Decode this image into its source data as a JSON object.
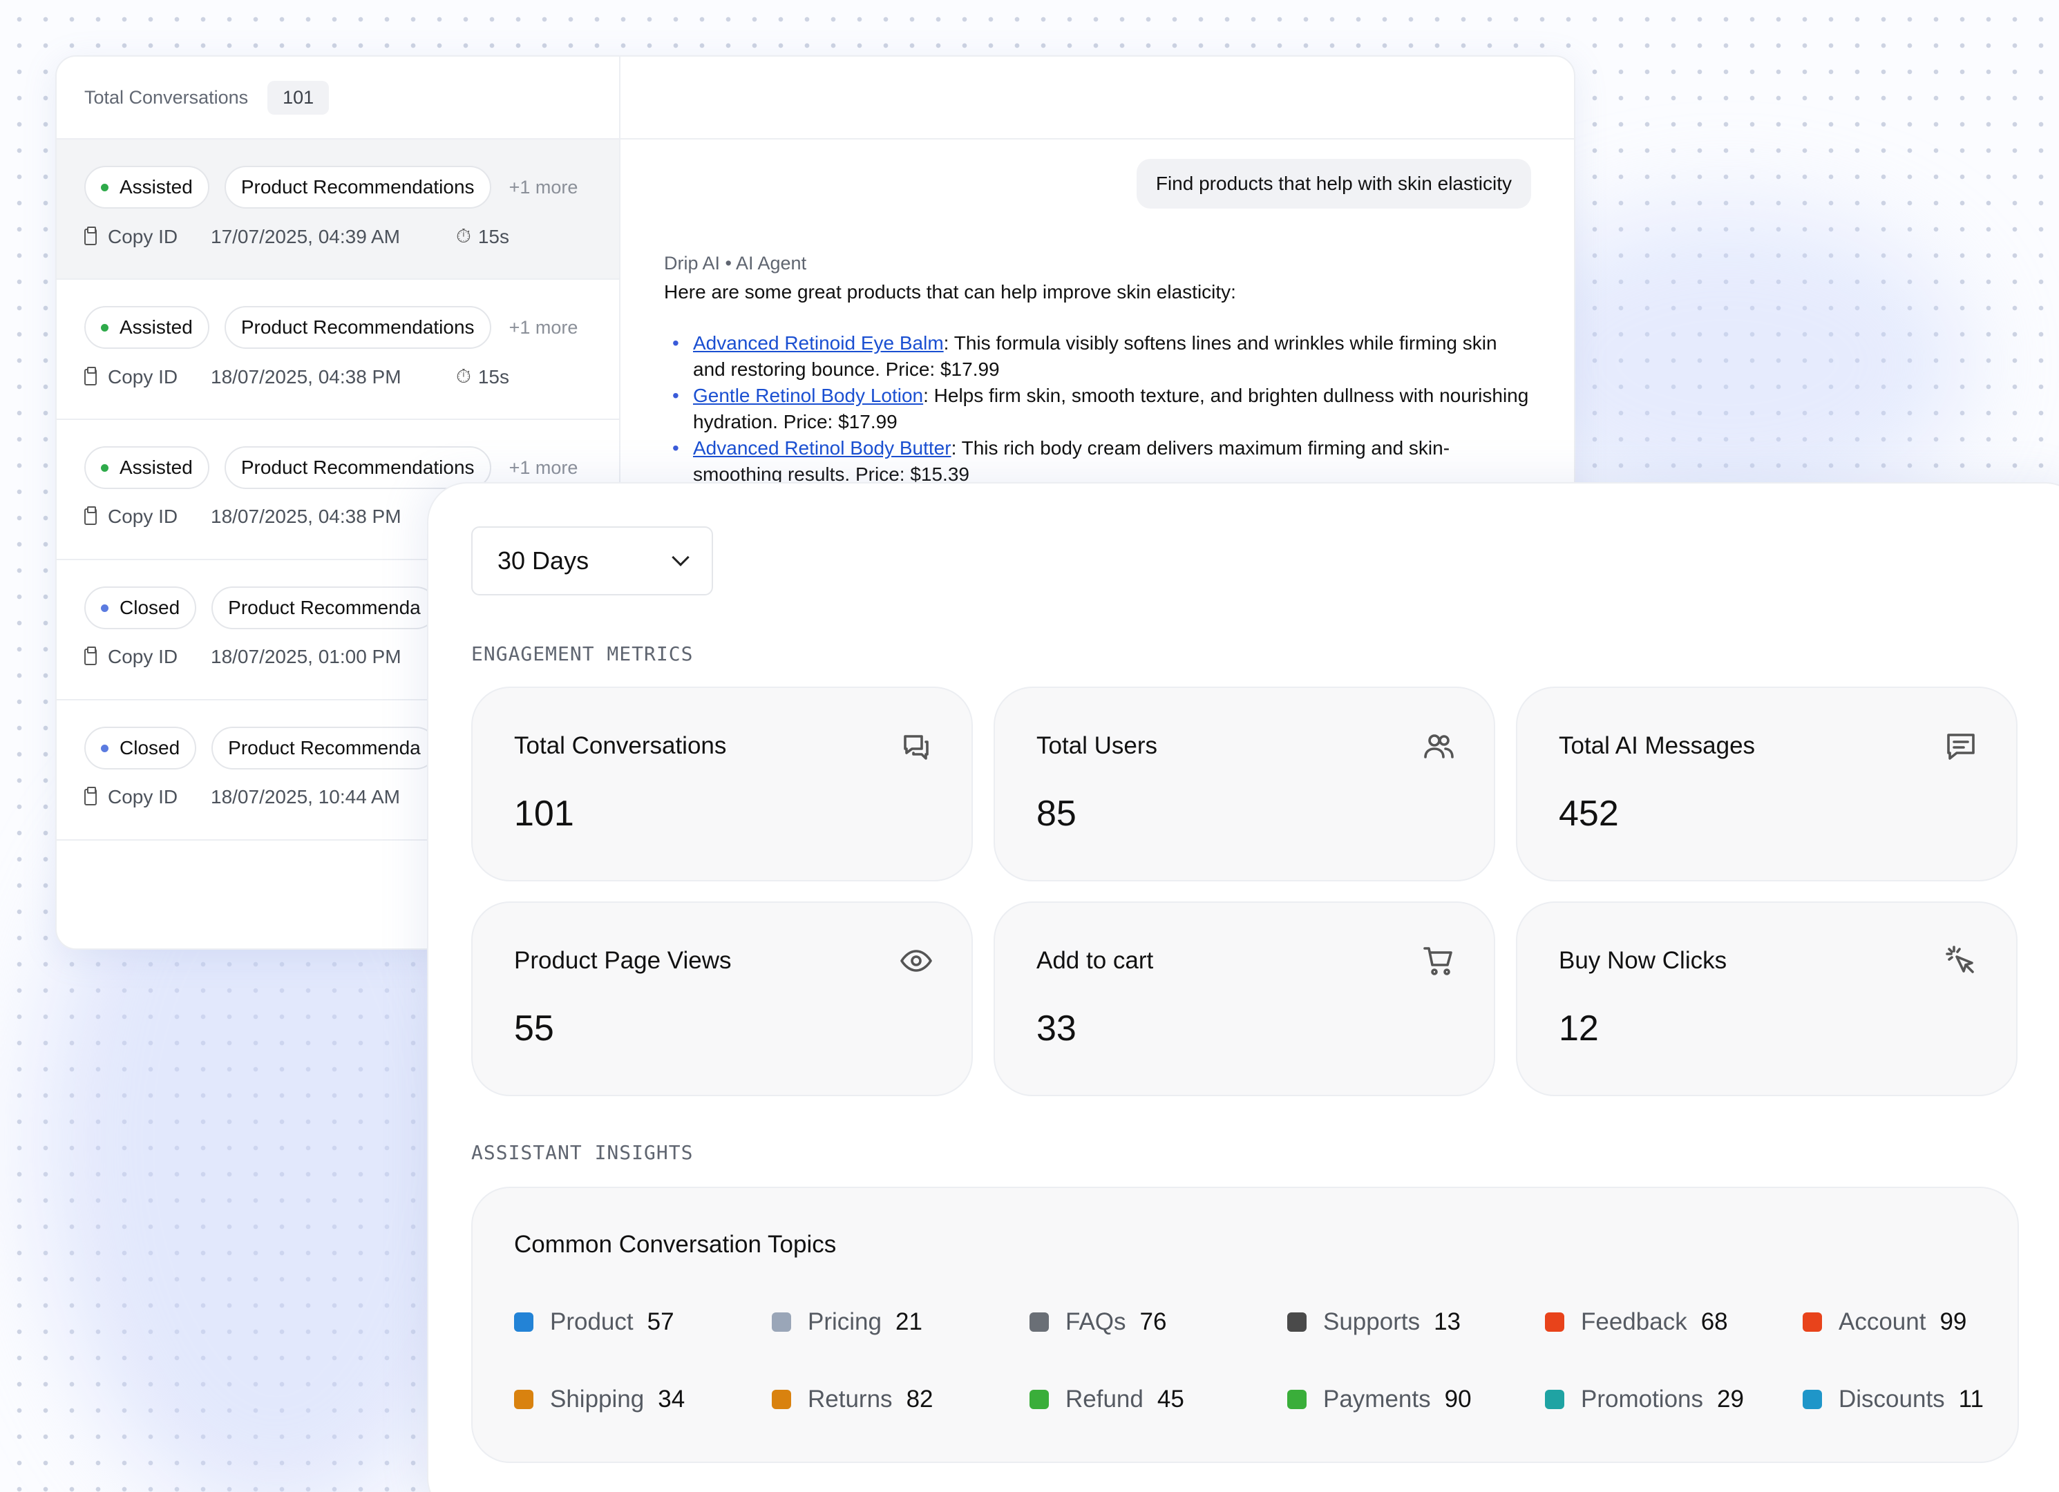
{
  "conversations_panel": {
    "header_title": "Total Conversations",
    "header_count": "101",
    "items": [
      {
        "status": "Assisted",
        "status_color": "#2eaa4a",
        "topic": "Product Recommendations",
        "more": "+1 more",
        "copy": "Copy ID",
        "time": "17/07/2025, 04:39 AM",
        "duration": "15s"
      },
      {
        "status": "Assisted",
        "status_color": "#2eaa4a",
        "topic": "Product Recommendations",
        "more": "+1 more",
        "copy": "Copy ID",
        "time": "18/07/2025, 04:38 PM",
        "duration": "15s"
      },
      {
        "status": "Assisted",
        "status_color": "#2eaa4a",
        "topic": "Product Recommendations",
        "more": "+1 more",
        "copy": "Copy ID",
        "time": "18/07/2025, 04:38 PM"
      },
      {
        "status": "Closed",
        "status_color": "#5b7be0",
        "topic": "Product Recommenda",
        "copy": "Copy ID",
        "time": "18/07/2025, 01:00 PM"
      },
      {
        "status": "Closed",
        "status_color": "#5b7be0",
        "topic": "Product Recommenda",
        "copy": "Copy ID",
        "time": "18/07/2025, 10:44 AM"
      }
    ]
  },
  "chat": {
    "user_message": "Find products that help with skin elasticity",
    "agent_label": "Drip AI • AI Agent",
    "agent_intro": "Here are some great products that can help improve skin elasticity:",
    "products": [
      {
        "name": "Advanced Retinoid Eye Balm",
        "desc": ": This formula visibly softens lines and wrinkles while firming skin and restoring bounce. Price: ",
        "price": "$17.99"
      },
      {
        "name": "Gentle Retinol Body Lotion",
        "desc": ": Helps firm skin, smooth texture, and brighten dullness with nourishing hydration. Price: ",
        "price": "$17.99"
      },
      {
        "name": "Advanced Retinol Body Butter",
        "desc": ": This rich body cream delivers maximum firming and skin-smoothing results. Price: ",
        "price": "$15.39"
      }
    ]
  },
  "metrics_panel": {
    "period": "30 Days",
    "engagement_label": "ENGAGEMENT METRICS",
    "insights_label": "ASSISTANT INSIGHTS",
    "metrics": [
      {
        "title": "Total Conversations",
        "value": "101",
        "icon": "chat-bubbles-icon"
      },
      {
        "title": "Total Users",
        "value": "85",
        "icon": "users-icon"
      },
      {
        "title": "Total AI Messages",
        "value": "452",
        "icon": "message-icon"
      },
      {
        "title": "Product Page Views",
        "value": "55",
        "icon": "eye-icon"
      },
      {
        "title": "Add to cart",
        "value": "33",
        "icon": "cart-icon"
      },
      {
        "title": "Buy Now Clicks",
        "value": "12",
        "icon": "cursor-click-icon"
      }
    ],
    "topics_title": "Common Conversation Topics",
    "topics": [
      {
        "name": "Product",
        "count": "57",
        "color": "#2383d6"
      },
      {
        "name": "Pricing",
        "count": "21",
        "color": "#9aa6b8"
      },
      {
        "name": "FAQs",
        "count": "76",
        "color": "#6a6f76"
      },
      {
        "name": "Supports",
        "count": "13",
        "color": "#4a4a4a"
      },
      {
        "name": "Feedback",
        "count": "68",
        "color": "#e8431b"
      },
      {
        "name": "Account",
        "count": "99",
        "color": "#e8431b"
      },
      {
        "name": "Shipping",
        "count": "34",
        "color": "#d9820f"
      },
      {
        "name": "Returns",
        "count": "82",
        "color": "#d9820f"
      },
      {
        "name": "Refund",
        "count": "45",
        "color": "#3aae3a"
      },
      {
        "name": "Payments",
        "count": "90",
        "color": "#3aae3a"
      },
      {
        "name": "Promotions",
        "count": "29",
        "color": "#1fa3a3"
      },
      {
        "name": "Discounts",
        "count": "11",
        "color": "#1f96c9"
      }
    ]
  }
}
